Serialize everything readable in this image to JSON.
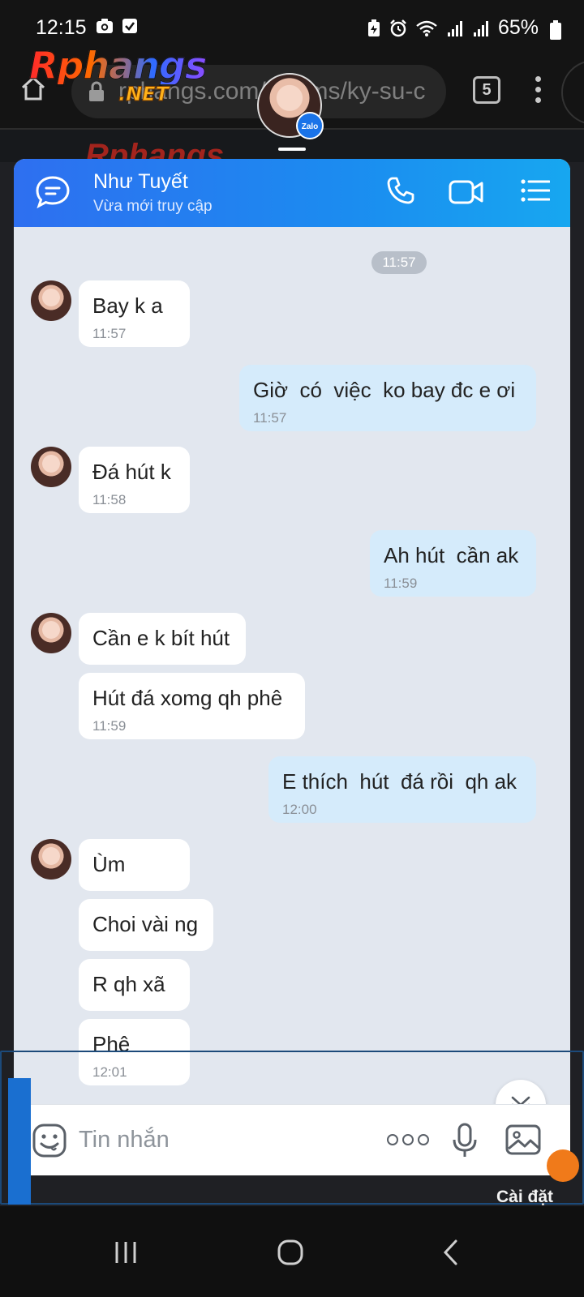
{
  "status_bar": {
    "time": "12:15",
    "battery": "65%"
  },
  "browser": {
    "url": "rphangs.com/forums/ky-su-c",
    "tab_count": "5"
  },
  "watermark": {
    "logo": "Rphangs",
    "suffix": ".NET"
  },
  "chathead": {
    "badge": "Zalo"
  },
  "chat_header": {
    "name": "Như Tuyết",
    "status": "Vừa mới truy cập"
  },
  "messages": {
    "time_divider": "11:57",
    "items": [
      {
        "dir": "in",
        "text": "Bay k a",
        "time": "11:57"
      },
      {
        "dir": "out",
        "text": "Giờ  có  việc  ko bay đc e ơi",
        "time": "11:57"
      },
      {
        "dir": "in",
        "text": "Đá hút k",
        "time": "11:58"
      },
      {
        "dir": "out",
        "text": "Ah hút  cần ak",
        "time": "11:59"
      },
      {
        "dir": "in",
        "text": "Cần e k bít hút",
        "time": ""
      },
      {
        "dir": "in",
        "text": "Hút đá xomg qh phê",
        "time": "11:59"
      },
      {
        "dir": "out",
        "text": "E thích  hút  đá rồi  qh ak",
        "time": "12:00"
      },
      {
        "dir": "in",
        "text": "Ùm",
        "time": ""
      },
      {
        "dir": "in",
        "text": "Choi vài ng",
        "time": ""
      },
      {
        "dir": "in",
        "text": "R qh xã",
        "time": ""
      },
      {
        "dir": "in",
        "text": "Phê",
        "time": "12:01"
      }
    ]
  },
  "input": {
    "placeholder": "Tin nhắn"
  },
  "page": {
    "settings_label": "Cài đặt"
  },
  "colors": {
    "header_start": "#2e6ff0",
    "header_end": "#17a7f0",
    "incoming_bubble": "#ffffff",
    "outgoing_bubble": "#d5ebfb",
    "chat_background": "#e2e7ef"
  },
  "icons": [
    "camera-icon",
    "check-icon",
    "alarm-icon",
    "wifi-icon",
    "signal-icon",
    "battery-icon",
    "home-icon",
    "lock-icon",
    "tabs-icon",
    "more-vert-icon",
    "chat-bubble-icon",
    "phone-icon",
    "video-icon",
    "list-icon",
    "chevron-double-down-icon",
    "emoji-icon",
    "more-horiz-icon",
    "mic-icon",
    "image-icon",
    "recent-apps-icon",
    "nav-home-icon",
    "back-icon"
  ]
}
